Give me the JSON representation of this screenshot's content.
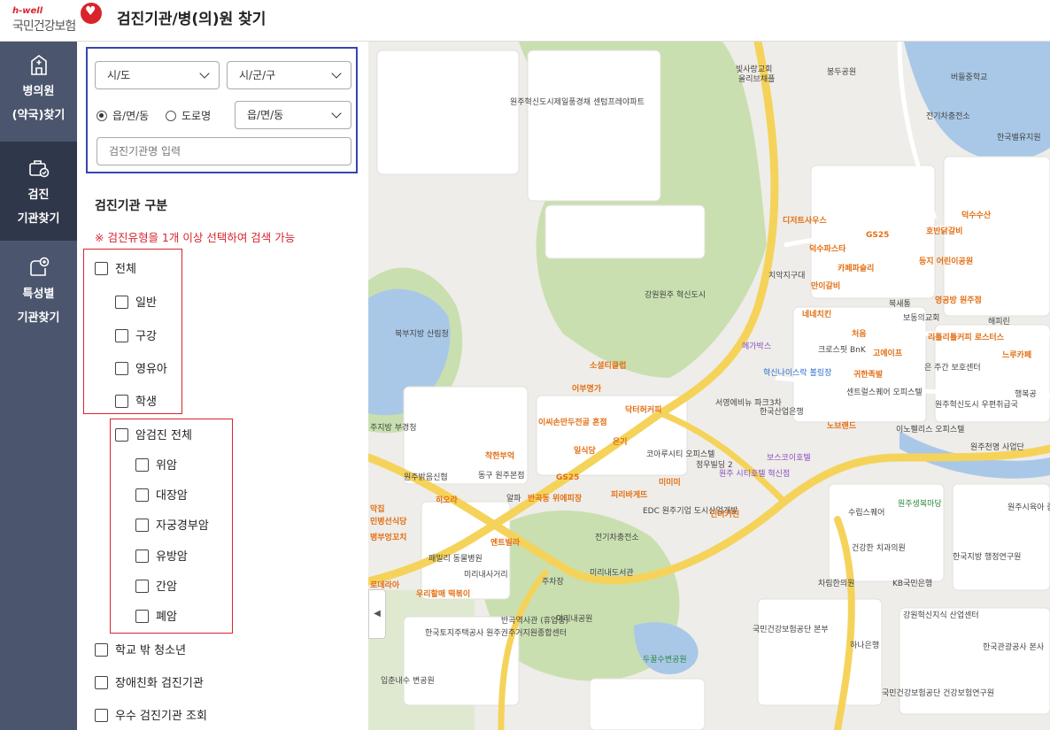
{
  "header": {
    "logo_tag": "h-well",
    "logo_name": "국민건강보험",
    "title": "검진기관/병(의)원 찾기"
  },
  "nav": {
    "items": [
      {
        "label1": "병의원",
        "label2": "(약국)찾기",
        "icon": "hospital-icon"
      },
      {
        "label1": "검진",
        "label2": "기관찾기",
        "icon": "checkup-icon"
      },
      {
        "label1": "특성별",
        "label2": "기관찾기",
        "icon": "specialty-icon"
      }
    ]
  },
  "search": {
    "sido": "시/도",
    "sigungu": "시/군/구",
    "radio_1": "읍/면/동",
    "radio_2": "도로명",
    "dong": "읍/면/동",
    "name_placeholder": "검진기관명 입력"
  },
  "filters": {
    "title": "검진기관 구분",
    "notice": "※ 검진유형을 1개 이상 선택하여 검색 가능",
    "all": "전체",
    "general": "일반",
    "oral": "구강",
    "infant": "영유아",
    "student": "학생",
    "cancer_all": "암검진 전체",
    "stomach": "위암",
    "colon": "대장암",
    "cervical": "자궁경부암",
    "breast": "유방암",
    "liver": "간암",
    "lung": "폐암",
    "out_of_school": "학교 밖 청소년",
    "disability": "장애친화 검진기관",
    "excellent": "우수 검진기관 조회"
  },
  "map": {
    "colors": {
      "road": "#f5d35a",
      "green": "#c9dfb0",
      "water": "#a9c8e8",
      "block": "#ffffff"
    },
    "labels": [
      "빛사랑교회",
      "올리브채플",
      "봉두공원",
      "버들중학교",
      "전기차충전소",
      "한국밸유지원",
      "원주혁신도시제일풍경채 센텀프레야파트",
      "강원원주 혁신도시",
      "디저트사우스",
      "덕수수산",
      "GS25",
      "호반닭갈비",
      "등지 어린이공원",
      "덕수파스타",
      "카페파슬리",
      "치악지구대",
      "만이갈비",
      "북새통",
      "영공방 원주점",
      "보동의교회",
      "해피린",
      "네네치킨",
      "처음",
      "메가박스",
      "크로스핏 BnK",
      "리틀리틀커피 로스터스",
      "고에이프",
      "느루카페",
      "혁신나이스락 볼링장",
      "귀한족발",
      "은 주간 보호센터",
      "행복공",
      "북부지방 산림청",
      "소셜티클럽",
      "어부명가",
      "이씨손만두전골 혼점",
      "닥터허커피",
      "서영에비뉴 파크3차",
      "한국산업은행",
      "센트럴스퀘어 오피스텔",
      "원주혁신도시 우편취급국",
      "노브랜드",
      "이노펠리스 오피스텔",
      "원주천명 사업단",
      "온기",
      "일식당",
      "코아루시티 오피스텔",
      "정우빌딩 2",
      "보스코이호텔",
      "원주 시티호텔 혁신점",
      "착한부억",
      "동구 원주본점",
      "원주밝음신협",
      "GS25",
      "알파",
      "반곡동 위에피장",
      "피리바게뜨",
      "미미미",
      "EDC 원주기업 도시산업개발",
      "인더키친",
      "수립스퀘어",
      "원주생복마당",
      "한국지방 행정연구원",
      "원주시육아 종합지원센터",
      "히오라",
      "엔트빌라",
      "전기차충전소",
      "패밀리 동물병원",
      "미리내사거리",
      "주차장",
      "미리내도서관",
      "건강한 치과의원",
      "차림한의원",
      "KB국민은행",
      "우리할매 떡볶이",
      "반곡역사관 (휴업중)",
      "미리내공원",
      "한국토지주택공사 원주권주거지원종합센터",
      "국민건강보험공단 본부",
      "강원혁신지식 산업센터",
      "하나은행",
      "한국관광공사 본사",
      "두꿀수변공원",
      "입춘내수 변공원",
      "국민건강보험공단 건강보험연구원",
      "주지방 부경청",
      "막집",
      "민병선식당",
      "병부엉꼬치",
      "로데라아"
    ]
  }
}
